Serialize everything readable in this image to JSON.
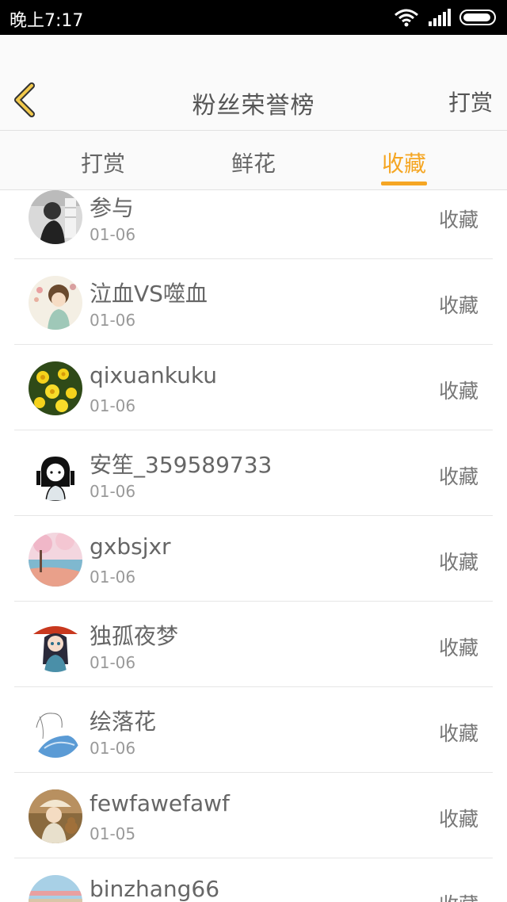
{
  "status_bar": {
    "time": "晚上7:17"
  },
  "header": {
    "title": "粉丝荣誉榜",
    "action": "打赏"
  },
  "tabs": [
    {
      "label": "打赏"
    },
    {
      "label": "鲜花"
    },
    {
      "label": "收藏"
    }
  ],
  "active_tab": "收藏",
  "colors": {
    "accent": "#f5a623",
    "text": "#666666",
    "muted": "#999999"
  },
  "list": [
    {
      "name": "参与",
      "date": "01-06",
      "action": "收藏",
      "avatar": "bw-photo"
    },
    {
      "name": "泣血VS噬血",
      "date": "01-06",
      "action": "收藏",
      "avatar": "anime-girl-flowers"
    },
    {
      "name": "qixuankuku",
      "date": "01-06",
      "action": "收藏",
      "avatar": "yellow-flowers"
    },
    {
      "name": "安笙_359589733",
      "date": "01-06",
      "action": "收藏",
      "avatar": "cartoon-girl"
    },
    {
      "name": "gxbsjxr",
      "date": "01-06",
      "action": "收藏",
      "avatar": "cherry-blossom-painting"
    },
    {
      "name": "独孤夜梦",
      "date": "01-06",
      "action": "收藏",
      "avatar": "anime-umbrella-girl"
    },
    {
      "name": "绘落花",
      "date": "01-06",
      "action": "收藏",
      "avatar": "sketch-blue"
    },
    {
      "name": "fewfawefawf",
      "date": "01-05",
      "action": "收藏",
      "avatar": "girl-with-teddy"
    },
    {
      "name": "binzhang66",
      "date": "",
      "action": "收藏",
      "avatar": "landscape"
    }
  ]
}
